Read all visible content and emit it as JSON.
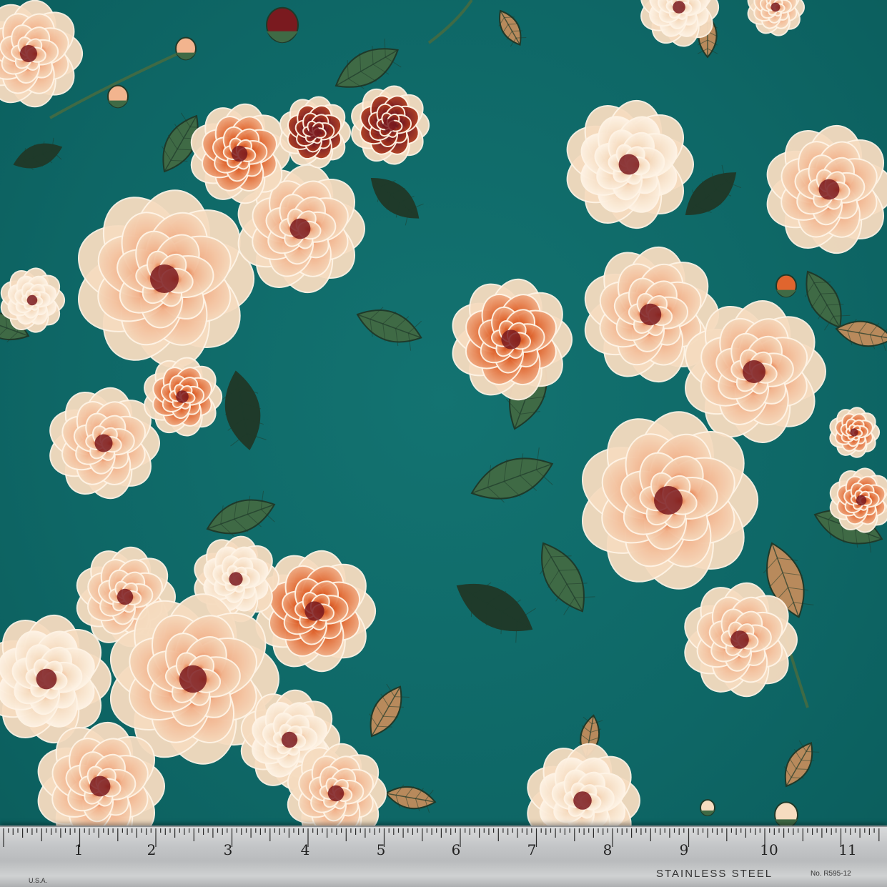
{
  "scene": {
    "subject": "teal floral fabric with measuring ruler",
    "palette": {
      "background": "#0f6b6a",
      "petal_cream": "#f6dcc0",
      "petal_peach": "#f2b48e",
      "petal_orange": "#e0652e",
      "petal_rust": "#b5401e",
      "petal_wine": "#7a1a1f",
      "leaf_dark": "#1f3a2a",
      "leaf_mid": "#3f6a45",
      "leaf_tan": "#b88a5c"
    }
  },
  "ruler": {
    "numbers": [
      "1",
      "2",
      "3",
      "4",
      "5",
      "6",
      "7",
      "8",
      "9",
      "10",
      "11"
    ],
    "brand_text": "STAINLESS STEEL",
    "model_text": "No. R595-12",
    "origin_text": "U.S.A."
  }
}
